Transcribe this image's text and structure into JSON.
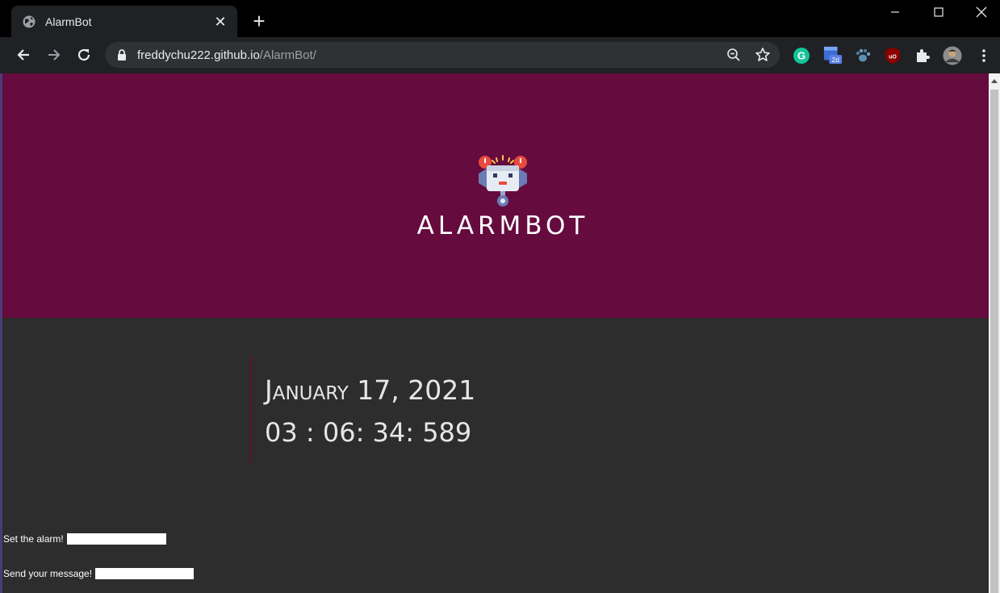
{
  "browser": {
    "tab_title": "AlarmBot",
    "url_host": "freddychu222.github.io",
    "url_path": "/AlarmBot/",
    "extension_badge": "2d"
  },
  "page": {
    "brand": "ALARMBOT",
    "date": "January 17, 2021",
    "time": "03 : 06: 34: 589",
    "alarm_label": "Set the alarm!",
    "alarm_value": "",
    "message_label": "Send your message!",
    "message_value": ""
  },
  "colors": {
    "hero_bg": "#650b3e",
    "page_bg": "#2d2d2d",
    "accent_line": "#5a1036"
  },
  "icons": [
    "globe-icon",
    "close-icon",
    "plus-icon",
    "minimize-icon",
    "maximize-icon",
    "window-close-icon",
    "back-arrow-icon",
    "forward-arrow-icon",
    "reload-icon",
    "lock-icon",
    "zoom-out-icon",
    "star-icon",
    "grammarly-icon",
    "extension-2d-icon",
    "paw-icon",
    "ublock-icon",
    "puzzle-icon",
    "profile-avatar-icon",
    "menu-dots-icon",
    "robot-logo-icon"
  ]
}
